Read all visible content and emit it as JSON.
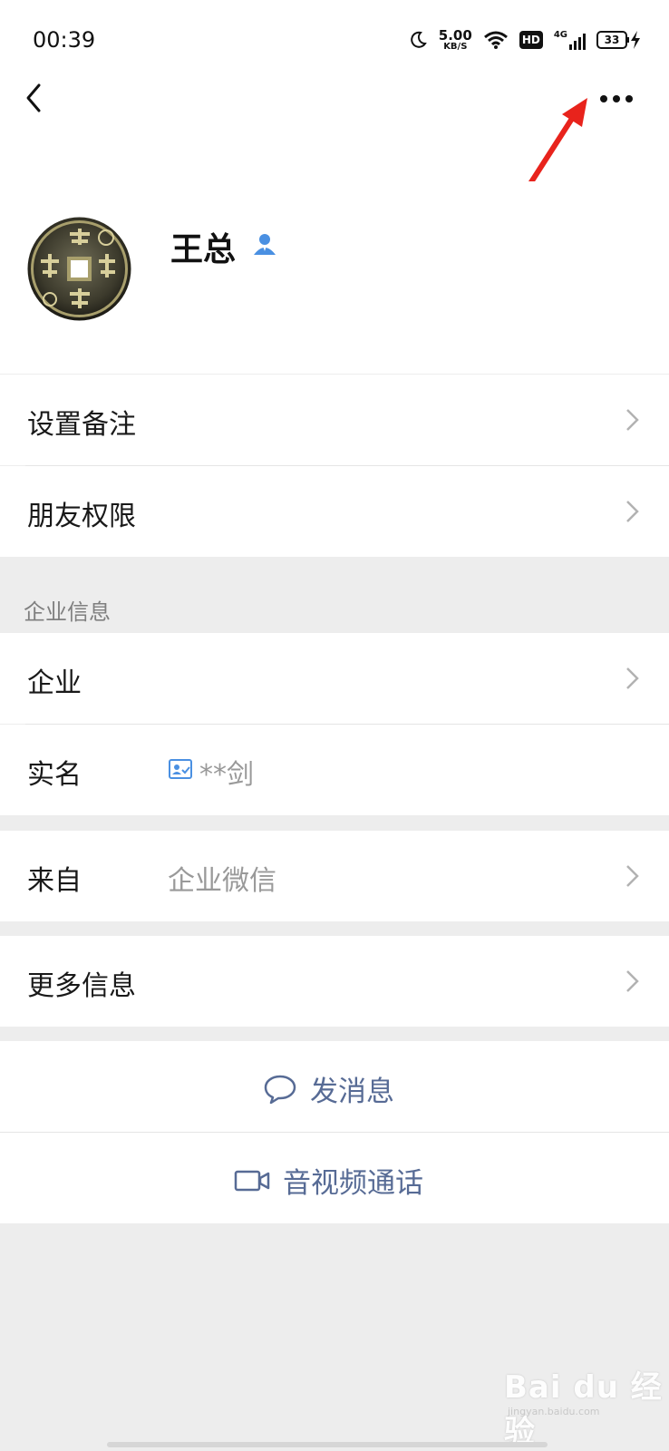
{
  "status_bar": {
    "time": "00:39",
    "net_speed_value": "5.00",
    "net_speed_unit": "KB/S",
    "hd_label": "HD",
    "signal_label": "4G",
    "battery_level": "33"
  },
  "navbar": {
    "back_icon": "chevron-left-icon",
    "more_icon": "more-dots-icon"
  },
  "profile": {
    "name": "王总",
    "badge_icon": "contact-person-icon"
  },
  "menu": {
    "set_remark": "设置备注",
    "friend_permission": "朋友权限"
  },
  "enterprise": {
    "section_title": "企业信息",
    "company_label": "企业",
    "realname_label": "实名",
    "realname_value": "**剑"
  },
  "source": {
    "label": "来自",
    "value": "企业微信"
  },
  "more_info": {
    "label": "更多信息"
  },
  "actions": {
    "send_message": "发消息",
    "video_call": "音视频通话"
  },
  "watermark": {
    "text": "Bai du 经验",
    "sub": "jingyan.baidu.com"
  },
  "colors": {
    "link": "#576b95",
    "annotation_arrow": "#e8231c",
    "badge": "#4a90e2"
  }
}
